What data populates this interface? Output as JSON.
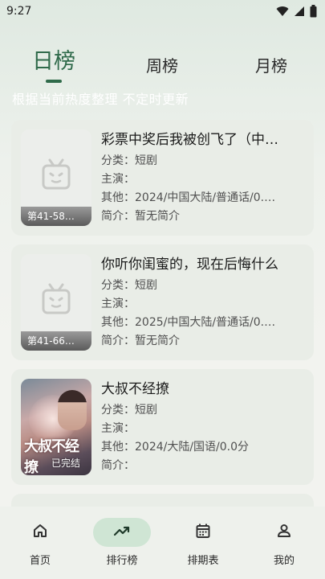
{
  "status_bar": {
    "time": "9:27",
    "icons": [
      "wifi-icon",
      "signal-icon",
      "battery-icon"
    ]
  },
  "tabs": [
    {
      "label": "日榜",
      "active": true
    },
    {
      "label": "周榜",
      "active": false
    },
    {
      "label": "月榜",
      "active": false
    }
  ],
  "subtitle": "根据当前热度整理 不定时更新",
  "cards": [
    {
      "title": "彩票中奖后我被创飞了（中…",
      "category": "分类：短剧",
      "cast": "主演：",
      "other": "其他：2024/中国大陆/普通话/0.…",
      "intro": "简介：暂无简介",
      "poster": "placeholder-tv-icon",
      "episode_badge": "第41-58…"
    },
    {
      "title": "你听你闺蜜的，现在后悔什么",
      "category": "分类：短剧",
      "cast": "主演：",
      "other": "其他：2025/中国大陆/普通话/0.…",
      "intro": "简介：暂无简介",
      "poster": "placeholder-tv-icon",
      "episode_badge": "第41-66…"
    },
    {
      "title": "大叔不经撩",
      "category": "分类：短剧",
      "cast": "主演：",
      "other": "其他：2024/大陆/国语/0.0分",
      "intro": "简介：",
      "poster": "image",
      "poster_title": "大叔不经撩",
      "poster_status": "已完结"
    }
  ],
  "bottom_nav": [
    {
      "label": "首页",
      "icon": "home-icon",
      "active": false
    },
    {
      "label": "排行榜",
      "icon": "trending-icon",
      "active": true
    },
    {
      "label": "排期表",
      "icon": "calendar-icon",
      "active": false
    },
    {
      "label": "我的",
      "icon": "person-icon",
      "active": false
    }
  ],
  "colors": {
    "accent": "#2f6a4a",
    "nav_active_pill": "#cfe5d4",
    "card_bg": "#e9ede7"
  }
}
